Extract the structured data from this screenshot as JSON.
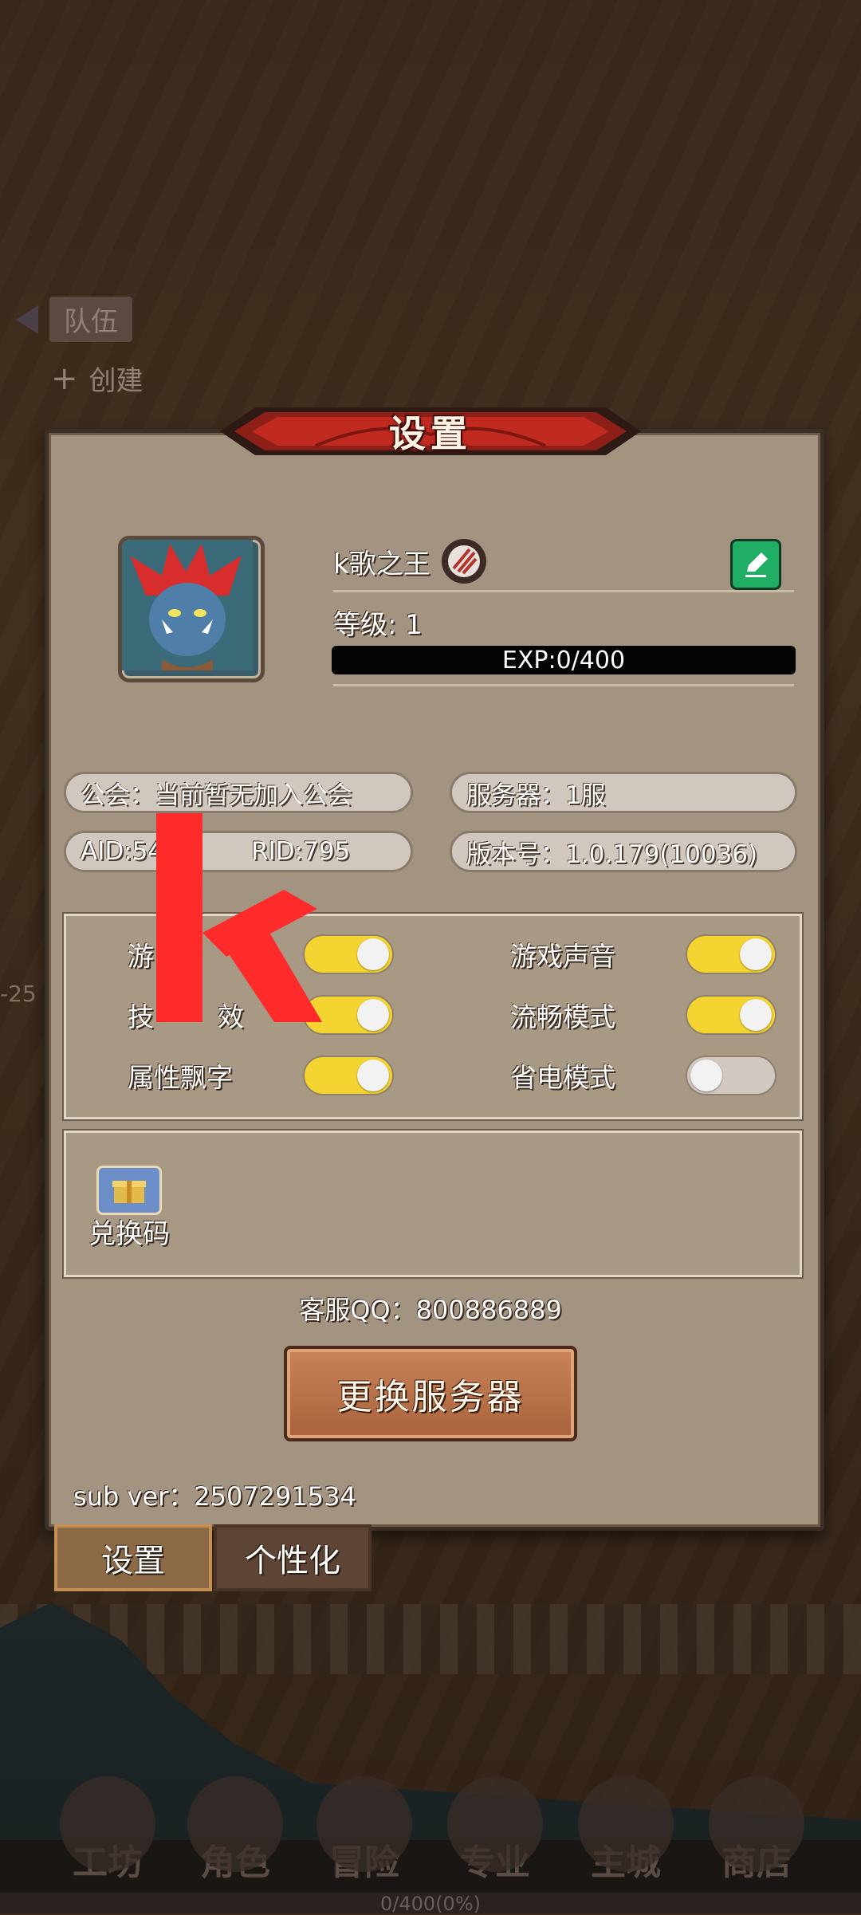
{
  "background": {
    "side_team_label": "队伍",
    "side_create_label": "创建",
    "side_number": "-25"
  },
  "dialog": {
    "title": "设置",
    "player": {
      "name": "k歌之王",
      "level_text": "等级: 1",
      "exp_text": "EXP:0/400",
      "exp_fraction": 0.0
    },
    "info": {
      "guild": "公会：当前暂无加入公会",
      "server": "服务器：1服",
      "ids": "AID:54",
      "rid": "RID:795",
      "version": "版本号：1.0.179(10036)"
    },
    "toggles": [
      {
        "label": "游戏音乐",
        "on": true
      },
      {
        "label": "游戏声音",
        "on": true
      },
      {
        "label": "技能特效",
        "on": true
      },
      {
        "label": "流畅模式",
        "on": true
      },
      {
        "label": "属性飘字",
        "on": true
      },
      {
        "label": "省电模式",
        "on": false
      }
    ],
    "visible_labels": {
      "music_partial": "游",
      "skill_partial_a": "技",
      "skill_partial_b": "效"
    },
    "redeem_label": "兑换码",
    "customer_service": "客服QQ：800886889",
    "change_server_button": "更换服务器",
    "sub_version": "sub ver：2507291534"
  },
  "tabs": {
    "settings": "设置",
    "personalize": "个性化"
  },
  "bottom_nav": {
    "items": [
      "工坊",
      "角色",
      "冒险",
      "专业",
      "主城",
      "商店"
    ],
    "progress_text": "0/400(0%)"
  },
  "overlay_letter": "k",
  "colors": {
    "toggle_on": "#f4d431",
    "toggle_off": "#d2c9c2",
    "edit_button": "#1fae63",
    "overlay_red": "#ff2a2a"
  }
}
